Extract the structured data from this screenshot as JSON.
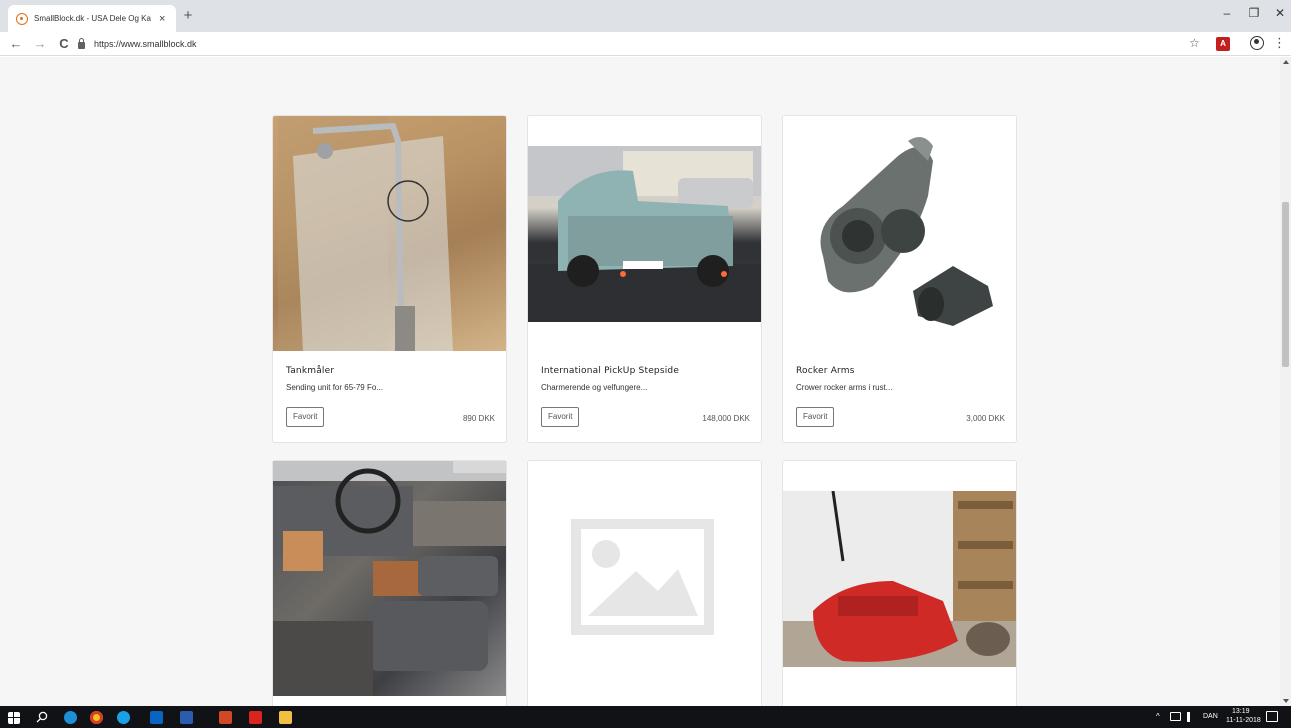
{
  "browser": {
    "tab_title": "SmallBlock.dk - USA Dele Og Ka",
    "tab_close": "×",
    "new_tab": "+",
    "url": "https://www.smallblock.dk",
    "minimize": "–",
    "maximize": "❐",
    "close": "✕",
    "back": "←",
    "forward": "→",
    "reload": "C",
    "star": "☆",
    "menu": "⋮",
    "pdf_ext": "A"
  },
  "products": [
    {
      "title": "Tankmåler",
      "desc": "Sending unit for 65-79 Fo...",
      "fav": "Favorit",
      "price": "890 DKK",
      "image": "tank-sender-photo"
    },
    {
      "title": "International PickUp Stepside",
      "desc": "Charmerende og velfungere...",
      "fav": "Favorit",
      "price": "148,000 DKK",
      "image": "pickup-truck-photo"
    },
    {
      "title": "Rocker Arms",
      "desc": "Crower rocker arms i rust...",
      "fav": "Favorit",
      "price": "3,000 DKK",
      "image": "rocker-arm-photo"
    },
    {
      "title": "",
      "desc": "",
      "fav": "",
      "price": "",
      "image": "truck-interior-photo"
    },
    {
      "title": "",
      "desc": "",
      "fav": "",
      "price": "",
      "image": "image-placeholder-icon"
    },
    {
      "title": "",
      "desc": "",
      "fav": "",
      "price": "",
      "image": "transmission-photo"
    }
  ],
  "taskbar": {
    "language": "DAN",
    "time": "13:19",
    "date": "11-11-2018",
    "tray_arrow": "^"
  },
  "colors": {
    "page_bg": "#f6f6f6",
    "card_border": "#e4e4e4",
    "taskbar_bg": "#101216"
  }
}
